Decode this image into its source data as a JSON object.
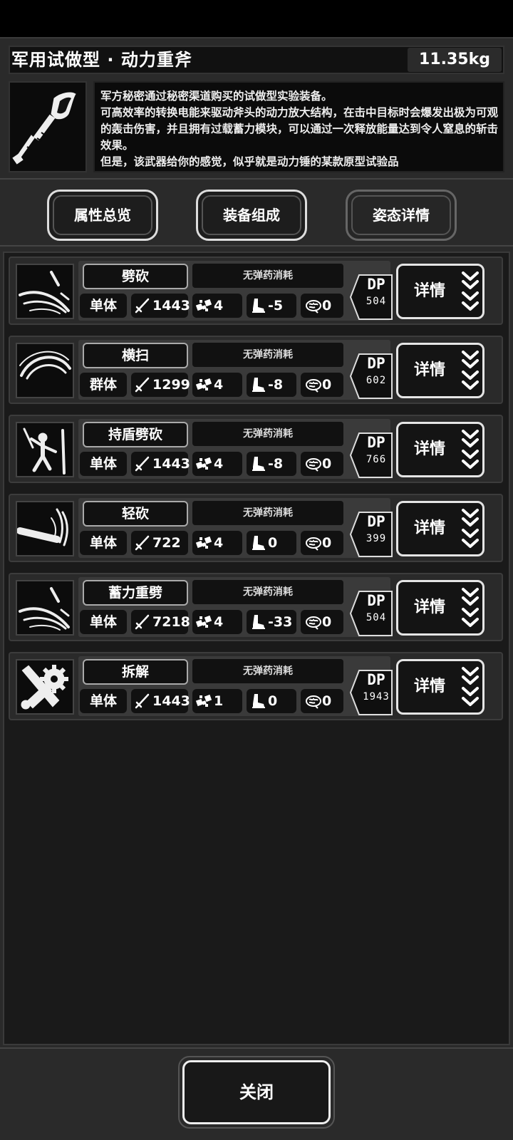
{
  "header": {
    "title": "军用试做型 · 动力重斧",
    "weight": "11.35kg",
    "description": "军方秘密通过秘密渠道购买的试做型实验装备。\n可高效率的转换电能来驱动斧头的动力放大结构，在击中目标时会爆发出极为可观的轰击伤害，并且拥有过载蓄力模块，可以通过一次释放能量达到令人窒息的斩击效果。\n但是，该武器给你的感觉，似乎就是动力锤的某款原型试验品"
  },
  "tabs": [
    {
      "label": "属性总览",
      "active": false
    },
    {
      "label": "装备组成",
      "active": false
    },
    {
      "label": "姿态详情",
      "active": true
    }
  ],
  "skills": [
    {
      "name": "劈砍",
      "ammo": "无弹药消耗",
      "target": "单体",
      "damage": "1443",
      "hit": "4",
      "move": "-5",
      "brain": "0",
      "dp_label": "DP",
      "dp": "504",
      "detail": "详情",
      "icon": "slash-icon"
    },
    {
      "name": "横扫",
      "ammo": "无弹药消耗",
      "target": "群体",
      "damage": "1299",
      "hit": "4",
      "move": "-8",
      "brain": "0",
      "dp_label": "DP",
      "dp": "602",
      "detail": "详情",
      "icon": "sweep-icon"
    },
    {
      "name": "持盾劈砍",
      "ammo": "无弹药消耗",
      "target": "单体",
      "damage": "1443",
      "hit": "4",
      "move": "-8",
      "brain": "0",
      "dp_label": "DP",
      "dp": "766",
      "detail": "详情",
      "icon": "shield-slash-icon"
    },
    {
      "name": "轻砍",
      "ammo": "无弹药消耗",
      "target": "单体",
      "damage": "722",
      "hit": "4",
      "move": "0",
      "brain": "0",
      "dp_label": "DP",
      "dp": "399",
      "detail": "详情",
      "icon": "light-slash-icon"
    },
    {
      "name": "蓄力重劈",
      "ammo": "无弹药消耗",
      "target": "单体",
      "damage": "7218",
      "hit": "4",
      "move": "-33",
      "brain": "0",
      "dp_label": "DP",
      "dp": "504",
      "detail": "详情",
      "icon": "charged-slash-icon"
    },
    {
      "name": "拆解",
      "ammo": "无弹药消耗",
      "target": "单体",
      "damage": "1443",
      "hit": "1",
      "move": "0",
      "brain": "0",
      "dp_label": "DP",
      "dp": "1943",
      "detail": "详情",
      "icon": "dismantle-icon"
    }
  ],
  "footer": {
    "close_label": "关闭"
  }
}
